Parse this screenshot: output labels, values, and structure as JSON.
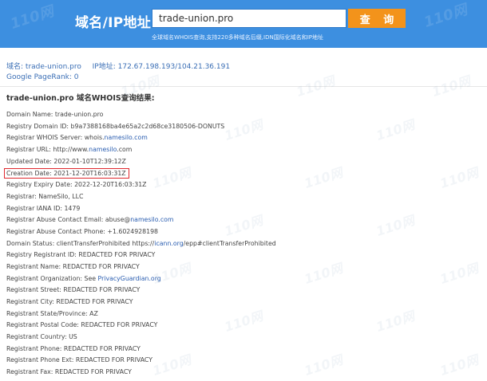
{
  "header": {
    "brand": "域名/IP地址:",
    "search_value": "trade-union.pro",
    "search_button": "查 询",
    "subtitle": "全球域名WHOIS查询,支持220多种域名后缀,IDN国际化域名和IP地址",
    "watermark": "110网"
  },
  "meta": {
    "domain_label": "域名:",
    "domain_value": "trade-union.pro",
    "ip_label": "IP地址:",
    "ip_value": "172.67.198.193/104.21.36.191",
    "pagerank_label": "Google PageRank:",
    "pagerank_value": "0"
  },
  "result_title": "trade-union.pro 域名WHOIS查询结果:",
  "records": [
    {
      "k": "Domain Name: ",
      "v": "trade-union.pro"
    },
    {
      "k": "Registry Domain ID: ",
      "v": "b9a7388168ba4e65a2c2d68ce3180506-DONUTS"
    },
    {
      "k": "Registrar WHOIS Server: ",
      "v": "whois.",
      "link": "namesilo.com"
    },
    {
      "k": "Registrar URL: ",
      "v": "http://www.",
      "link": "namesilo",
      "v2": ".com"
    },
    {
      "k": "Updated Date: ",
      "v": "2022-01-10T12:39:12Z"
    },
    {
      "k": "Creation Date: ",
      "v": "2021-12-20T16:03:31Z",
      "highlight": true
    },
    {
      "k": "Registry Expiry Date: ",
      "v": "2022-12-20T16:03:31Z"
    },
    {
      "k": "Registrar: ",
      "v": "NameSilo, LLC"
    },
    {
      "k": "Registrar IANA ID: ",
      "v": "1479"
    },
    {
      "k": "Registrar Abuse Contact Email: ",
      "v": "abuse@",
      "link": "namesilo.com"
    },
    {
      "k": "Registrar Abuse Contact Phone: ",
      "v": "+1.6024928198"
    },
    {
      "k": "Domain Status: ",
      "v": "clientTransferProhibited https://",
      "link": "icann.org",
      "v2": "/epp#clientTransferProhibited"
    },
    {
      "k": "Registry Registrant ID: ",
      "v": "REDACTED FOR PRIVACY"
    },
    {
      "k": "Registrant Name: ",
      "v": "REDACTED FOR PRIVACY"
    },
    {
      "k": "Registrant Organization: ",
      "v": "See ",
      "link": "PrivacyGuardian.org"
    },
    {
      "k": "Registrant Street: ",
      "v": "REDACTED FOR PRIVACY"
    },
    {
      "k": "Registrant City: ",
      "v": "REDACTED FOR PRIVACY"
    },
    {
      "k": "Registrant State/Province: ",
      "v": "AZ"
    },
    {
      "k": "Registrant Postal Code: ",
      "v": "REDACTED FOR PRIVACY"
    },
    {
      "k": "Registrant Country: ",
      "v": "US"
    },
    {
      "k": "Registrant Phone: ",
      "v": "REDACTED FOR PRIVACY"
    },
    {
      "k": "Registrant Phone Ext: ",
      "v": "REDACTED FOR PRIVACY"
    },
    {
      "k": "Registrant Fax: ",
      "v": "REDACTED FOR PRIVACY"
    }
  ],
  "colors": {
    "header_bg": "#3d8fe0",
    "button_bg": "#f3931b",
    "link": "#2a5db0",
    "highlight_border": "#e0282e"
  }
}
